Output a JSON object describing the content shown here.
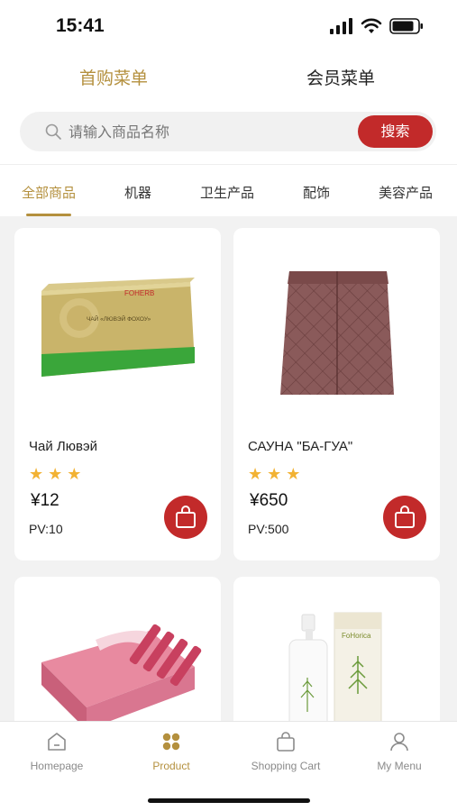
{
  "status": {
    "time": "15:41"
  },
  "menu_tabs": [
    "首购菜单",
    "会员菜单"
  ],
  "search": {
    "placeholder": "请输入商品名称",
    "button_label": "搜索"
  },
  "categories": [
    "全部商品",
    "机器",
    "卫生产品",
    "配饰",
    "美容产品"
  ],
  "products": [
    {
      "name": "Чай Лювэй",
      "stars": "★★★",
      "price": "¥12",
      "pv": "PV:10",
      "box_brand": "FOHERB",
      "box_title": "ЧАЙ «ЛЮВЭЙ ФОХОУ»"
    },
    {
      "name": "САУНА \"БА-ГУА\"",
      "stars": "★★★",
      "price": "¥650",
      "pv": "PV:500"
    },
    {
      "name": "",
      "stars": "",
      "price": "",
      "pv": ""
    },
    {
      "name": "",
      "stars": "",
      "price": "",
      "pv": "",
      "bottle_brand": "FoHorica"
    }
  ],
  "tabbar": [
    "Homepage",
    "Product",
    "Shopping Cart",
    "My Menu"
  ],
  "colors": {
    "accent_gold": "#b4903e",
    "brand_red": "#c22a2a",
    "star": "#f2b233"
  }
}
